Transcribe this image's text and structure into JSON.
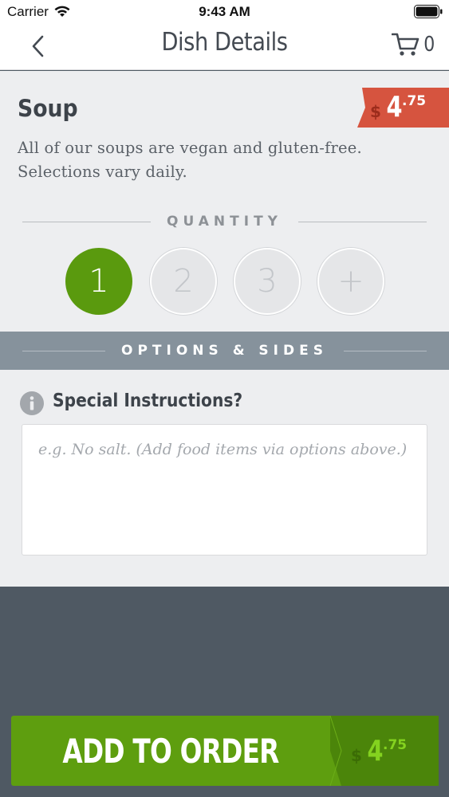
{
  "status_bar": {
    "carrier": "Carrier",
    "time": "9:43 AM"
  },
  "nav": {
    "title": "Dish Details",
    "cart_count": "0"
  },
  "dish": {
    "name": "Soup",
    "description": "All of our soups are vegan and gluten-free. Selections vary daily.",
    "price": {
      "currency": "$",
      "whole": "4",
      "cents": ".75"
    }
  },
  "quantity": {
    "label": "QUANTITY",
    "options": [
      "1",
      "2",
      "3",
      "+"
    ],
    "selected": "1"
  },
  "options_section": {
    "label": "OPTIONS & SIDES"
  },
  "instructions": {
    "label": "Special Instructions?",
    "placeholder": "e.g. No salt. (Add food items via options above.)",
    "value": ""
  },
  "add_button": {
    "label": "ADD TO ORDER",
    "price_currency": "$",
    "price_whole": "4",
    "price_cents": ".75"
  },
  "colors": {
    "accent_green": "#5a9a0e",
    "price_tag_red": "#d6543f",
    "options_band": "#86929c",
    "footer_bg": "#4f5963"
  }
}
